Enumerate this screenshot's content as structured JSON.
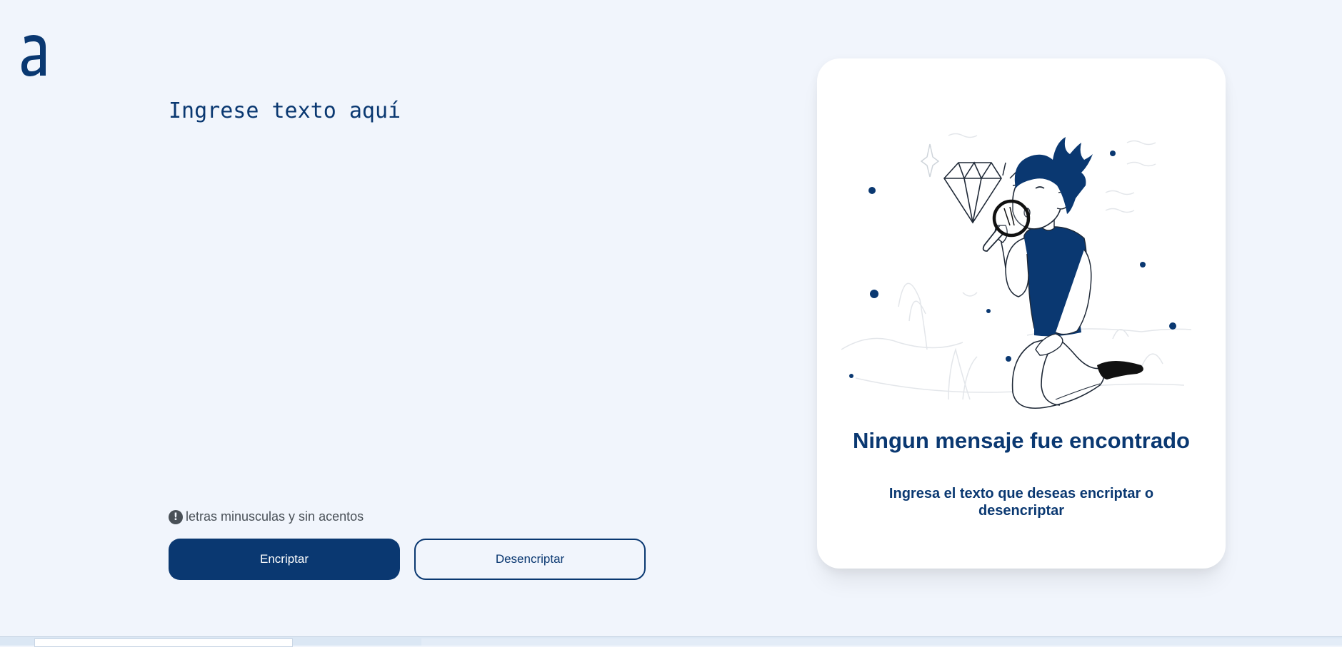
{
  "app": {
    "logo_icon": "alura-a-logo-icon",
    "colors": {
      "primary": "#0a3871",
      "background": "#f1f5fc",
      "hint": "#495057",
      "card": "#ffffff"
    }
  },
  "input": {
    "placeholder": "Ingrese texto aquí",
    "value": ""
  },
  "hint": {
    "icon": "exclamation-circle-icon",
    "text": "letras minusculas y sin acentos"
  },
  "buttons": {
    "encrypt_label": "Encriptar",
    "decrypt_label": "Desencriptar"
  },
  "output_card": {
    "illustration": "person-with-magnifying-glass-and-diamond-illustration",
    "title": "Ningun mensaje fue encontrado",
    "subtitle": "Ingresa el texto que deseas encriptar o desencriptar"
  }
}
